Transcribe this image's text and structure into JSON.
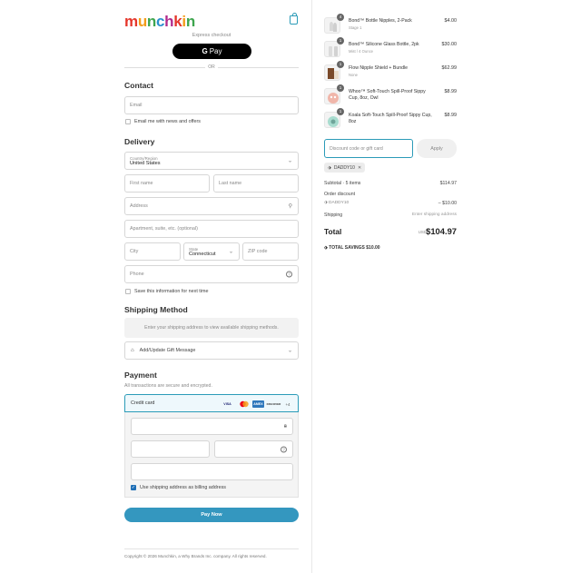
{
  "brand": {
    "logo_letters": [
      "m",
      "u",
      "n",
      "c",
      "h",
      "k",
      "i",
      "n"
    ]
  },
  "express": {
    "label": "Express checkout",
    "gpay_g": "G",
    "gpay_text": "Pay",
    "or": "OR"
  },
  "contact": {
    "heading": "Contact",
    "email_placeholder": "Email",
    "newsletter_label": "Email me with news and offers"
  },
  "delivery": {
    "heading": "Delivery",
    "country_label": "Country/Region",
    "country_value": "United States",
    "first_name": "First name",
    "last_name": "Last name",
    "address": "Address",
    "apartment": "Apartment, suite, etc. (optional)",
    "city": "City",
    "state_label": "State",
    "state_value": "Connecticut",
    "zip": "ZIP code",
    "phone": "Phone",
    "save_label": "Save this information for next time"
  },
  "shipping": {
    "heading": "Shipping Method",
    "notice": "Enter your shipping address to view available shipping methods.",
    "gift_label": "Add/Update Gift Message"
  },
  "payment": {
    "heading": "Payment",
    "subtitle": "All transactions are secure and encrypted.",
    "credit_card_label": "Credit card",
    "card_brands": [
      "VISA",
      "MC",
      "AMEX",
      "DISCOVER",
      "+4"
    ],
    "billing_same_label": "Use shipping address as billing address",
    "pay_button": "Pay Now"
  },
  "footer": {
    "copyright": "Copyright © 2026 Munchkin, a Why Brands Inc. company. All rights reserved."
  },
  "order": {
    "items": [
      {
        "qty": "4",
        "name": "Bond™ Bottle Nipples, 2-Pack",
        "variant": "Stage 1",
        "price": "$4.00"
      },
      {
        "qty": "1",
        "name": "Bond™ Silicone Glass Bottle, 2pk",
        "variant": "Mist / 4 Ounce",
        "price": "$30.00"
      },
      {
        "qty": "1",
        "name": "Flow Nipple Shield + Bundle",
        "variant": "None",
        "price": "$62.99"
      },
      {
        "qty": "1",
        "name": "Whoo™ Soft-Touch Spill-Proof Sippy Cup, 8oz, Owl",
        "variant": "",
        "price": "$8.99"
      },
      {
        "qty": "1",
        "name": "Koala Soft-Touch Spill-Proof Sippy Cup, 8oz",
        "variant": "",
        "price": "$8.99"
      }
    ],
    "discount_placeholder": "Discount code or gift card",
    "apply_label": "Apply",
    "applied_code": "DADDY10",
    "subtotal_label": "Subtotal · 5 items",
    "subtotal_value": "$114.97",
    "order_discount_label": "Order discount",
    "discount_code": "DADDY10",
    "discount_value": "– $10.00",
    "shipping_label": "Shipping",
    "shipping_value": "Enter shipping address",
    "total_label": "Total",
    "currency": "USD",
    "total_value": "$104.97",
    "savings_label": "TOTAL SAVINGS",
    "savings_value": "$10.00"
  }
}
